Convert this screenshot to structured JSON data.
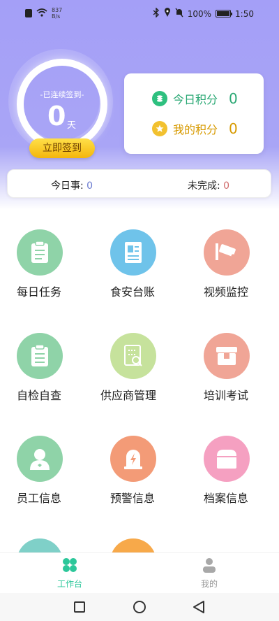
{
  "status_bar": {
    "net_speed": "837",
    "net_unit": "B/s",
    "battery_pct": "100%",
    "time": "1:50"
  },
  "signin": {
    "streak_label": "-已连续签到-",
    "streak_value": "0",
    "streak_unit": "天",
    "sign_button": "立即签到"
  },
  "points": {
    "today_label": "今日积分",
    "today_value": "0",
    "mine_label": "我的积分",
    "mine_value": "0"
  },
  "tasks": {
    "today_label": "今日事:",
    "today_value": "0",
    "unfinished_label": "未完成:",
    "unfinished_value": "0"
  },
  "grid": [
    {
      "label": "每日任务",
      "icon": "clipboard-icon",
      "color": "#8fd3a8"
    },
    {
      "label": "食安台账",
      "icon": "document-icon",
      "color": "#6fc3ea"
    },
    {
      "label": "视频监控",
      "icon": "camera-icon",
      "color": "#f0a596"
    },
    {
      "label": "自检自查",
      "icon": "checklist-icon",
      "color": "#8fd3a8"
    },
    {
      "label": "供应商管理",
      "icon": "search-document-icon",
      "color": "#c6e29c"
    },
    {
      "label": "培训考试",
      "icon": "box-icon",
      "color": "#f0a596"
    },
    {
      "label": "员工信息",
      "icon": "user-icon",
      "color": "#8fd3a8"
    },
    {
      "label": "预警信息",
      "icon": "alarm-icon",
      "color": "#f39b77"
    },
    {
      "label": "档案信息",
      "icon": "archive-icon",
      "color": "#f5a0c1"
    }
  ],
  "partial_row": [
    {
      "icon": "partial-icon",
      "color": "#7fd0c8"
    },
    {
      "icon": "partial-icon",
      "color": "#f7a94a"
    }
  ],
  "nav": {
    "work": "工作台",
    "mine": "我的"
  }
}
